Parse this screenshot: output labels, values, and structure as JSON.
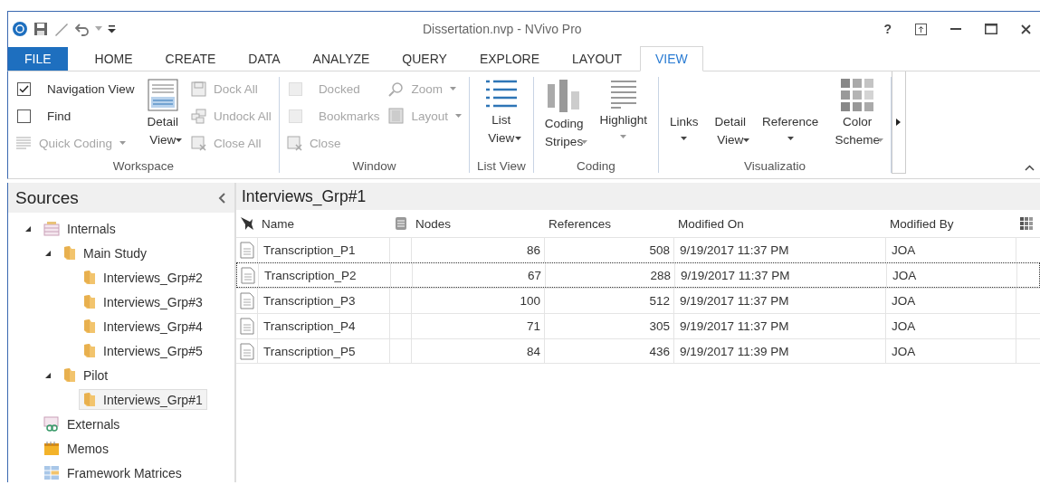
{
  "window": {
    "title": "Dissertation.nvp - NVivo Pro",
    "help": "?"
  },
  "tabs": [
    {
      "label": "FILE",
      "kind": "file",
      "selected": false
    },
    {
      "label": "HOME",
      "kind": "tab",
      "selected": false
    },
    {
      "label": "CREATE",
      "kind": "tab",
      "selected": false
    },
    {
      "label": "DATA",
      "kind": "tab",
      "selected": false
    },
    {
      "label": "ANALYZE",
      "kind": "tab",
      "selected": false
    },
    {
      "label": "QUERY",
      "kind": "tab",
      "selected": false
    },
    {
      "label": "EXPLORE",
      "kind": "tab",
      "selected": false
    },
    {
      "label": "LAYOUT",
      "kind": "tab",
      "selected": false
    },
    {
      "label": "VIEW",
      "kind": "tab",
      "selected": true
    }
  ],
  "ribbon": {
    "groups": [
      {
        "label": "Workspace",
        "columns": [
          [
            {
              "kind": "check",
              "label": "Navigation View",
              "checked": true,
              "disabled": false
            },
            {
              "kind": "check",
              "label": "Find",
              "checked": false,
              "disabled": false
            },
            {
              "kind": "small",
              "label": "Quick Coding",
              "disabled": true,
              "dropdown": true
            }
          ],
          [
            {
              "kind": "large",
              "lines": [
                "Detail",
                "View"
              ],
              "disabled": false,
              "dropdown": true
            }
          ],
          [
            {
              "kind": "small",
              "label": "Dock All",
              "disabled": true,
              "dropdown": false
            },
            {
              "kind": "small",
              "label": "Undock All",
              "disabled": true,
              "dropdown": false
            },
            {
              "kind": "small",
              "label": "Close All",
              "disabled": true,
              "dropdown": false
            }
          ]
        ]
      },
      {
        "label": "Window",
        "columns": [
          [
            {
              "kind": "check",
              "label": "Docked",
              "checked": false,
              "disabled": true
            },
            {
              "kind": "check",
              "label": "Bookmarks",
              "checked": false,
              "disabled": true
            },
            {
              "kind": "small",
              "label": "Close",
              "disabled": true,
              "dropdown": false
            }
          ],
          [
            {
              "kind": "small",
              "label": "Zoom",
              "disabled": true,
              "dropdown": true
            },
            {
              "kind": "small",
              "label": "Layout",
              "disabled": true,
              "dropdown": true
            }
          ]
        ]
      },
      {
        "label": "List View",
        "columns": [
          [
            {
              "kind": "large",
              "lines": [
                "List",
                "View"
              ],
              "disabled": false,
              "dropdown": true
            }
          ]
        ]
      },
      {
        "label": "Coding",
        "columns": [
          [
            {
              "kind": "large",
              "lines": [
                "Coding",
                "Stripes"
              ],
              "disabled": true,
              "dropdown": true
            }
          ],
          [
            {
              "kind": "large",
              "lines": [
                "Highlight"
              ],
              "disabled": true,
              "dropdown": true
            }
          ]
        ]
      },
      {
        "label": "Visualizatio",
        "columns": [
          [
            {
              "kind": "large",
              "lines": [
                "Links"
              ],
              "disabled": false,
              "dropdown": true
            }
          ],
          [
            {
              "kind": "large",
              "lines": [
                "Detail",
                "View"
              ],
              "disabled": false,
              "dropdown": true
            }
          ],
          [
            {
              "kind": "large",
              "lines": [
                "Reference"
              ],
              "disabled": false,
              "dropdown": true
            }
          ],
          [
            {
              "kind": "large",
              "lines": [
                "Color",
                "Scheme"
              ],
              "disabled": true,
              "dropdown": true
            }
          ]
        ]
      }
    ]
  },
  "sidebar": {
    "title": "Sources",
    "tree": [
      {
        "label": "Internals",
        "kind": "internals",
        "expanded": true,
        "selected": false,
        "children": [
          {
            "label": "Main Study",
            "kind": "folder",
            "expanded": true,
            "selected": false,
            "children": [
              {
                "label": "Interviews_Grp#2",
                "kind": "folder",
                "selected": false
              },
              {
                "label": "Interviews_Grp#3",
                "kind": "folder",
                "selected": false
              },
              {
                "label": "Interviews_Grp#4",
                "kind": "folder",
                "selected": false
              },
              {
                "label": "Interviews_Grp#5",
                "kind": "folder",
                "selected": false
              }
            ]
          },
          {
            "label": "Pilot",
            "kind": "folder",
            "expanded": true,
            "selected": false,
            "children": [
              {
                "label": "Interviews_Grp#1",
                "kind": "folder",
                "selected": true
              }
            ]
          }
        ]
      },
      {
        "label": "Externals",
        "kind": "externals",
        "selected": false
      },
      {
        "label": "Memos",
        "kind": "memos",
        "selected": false
      },
      {
        "label": "Framework Matrices",
        "kind": "matrices",
        "selected": false
      }
    ]
  },
  "table": {
    "title": "Interviews_Grp#1",
    "columns": [
      {
        "label": "Name"
      },
      {
        "label": "Nodes"
      },
      {
        "label": "References"
      },
      {
        "label": "Modified On"
      },
      {
        "label": "Modified By"
      }
    ],
    "rows": [
      {
        "name": "Transcription_P1",
        "nodes": "86",
        "references": "508",
        "modified_on": "9/19/2017 11:37 PM",
        "modified_by": "JOA",
        "focused": false
      },
      {
        "name": "Transcription_P2",
        "nodes": "67",
        "references": "288",
        "modified_on": "9/19/2017 11:37 PM",
        "modified_by": "JOA",
        "focused": true
      },
      {
        "name": "Transcription_P3",
        "nodes": "100",
        "references": "512",
        "modified_on": "9/19/2017 11:37 PM",
        "modified_by": "JOA",
        "focused": false
      },
      {
        "name": "Transcription_P4",
        "nodes": "71",
        "references": "305",
        "modified_on": "9/19/2017 11:37 PM",
        "modified_by": "JOA",
        "focused": false
      },
      {
        "name": "Transcription_P5",
        "nodes": "84",
        "references": "436",
        "modified_on": "9/19/2017 11:39 PM",
        "modified_by": "JOA",
        "focused": false
      }
    ]
  }
}
